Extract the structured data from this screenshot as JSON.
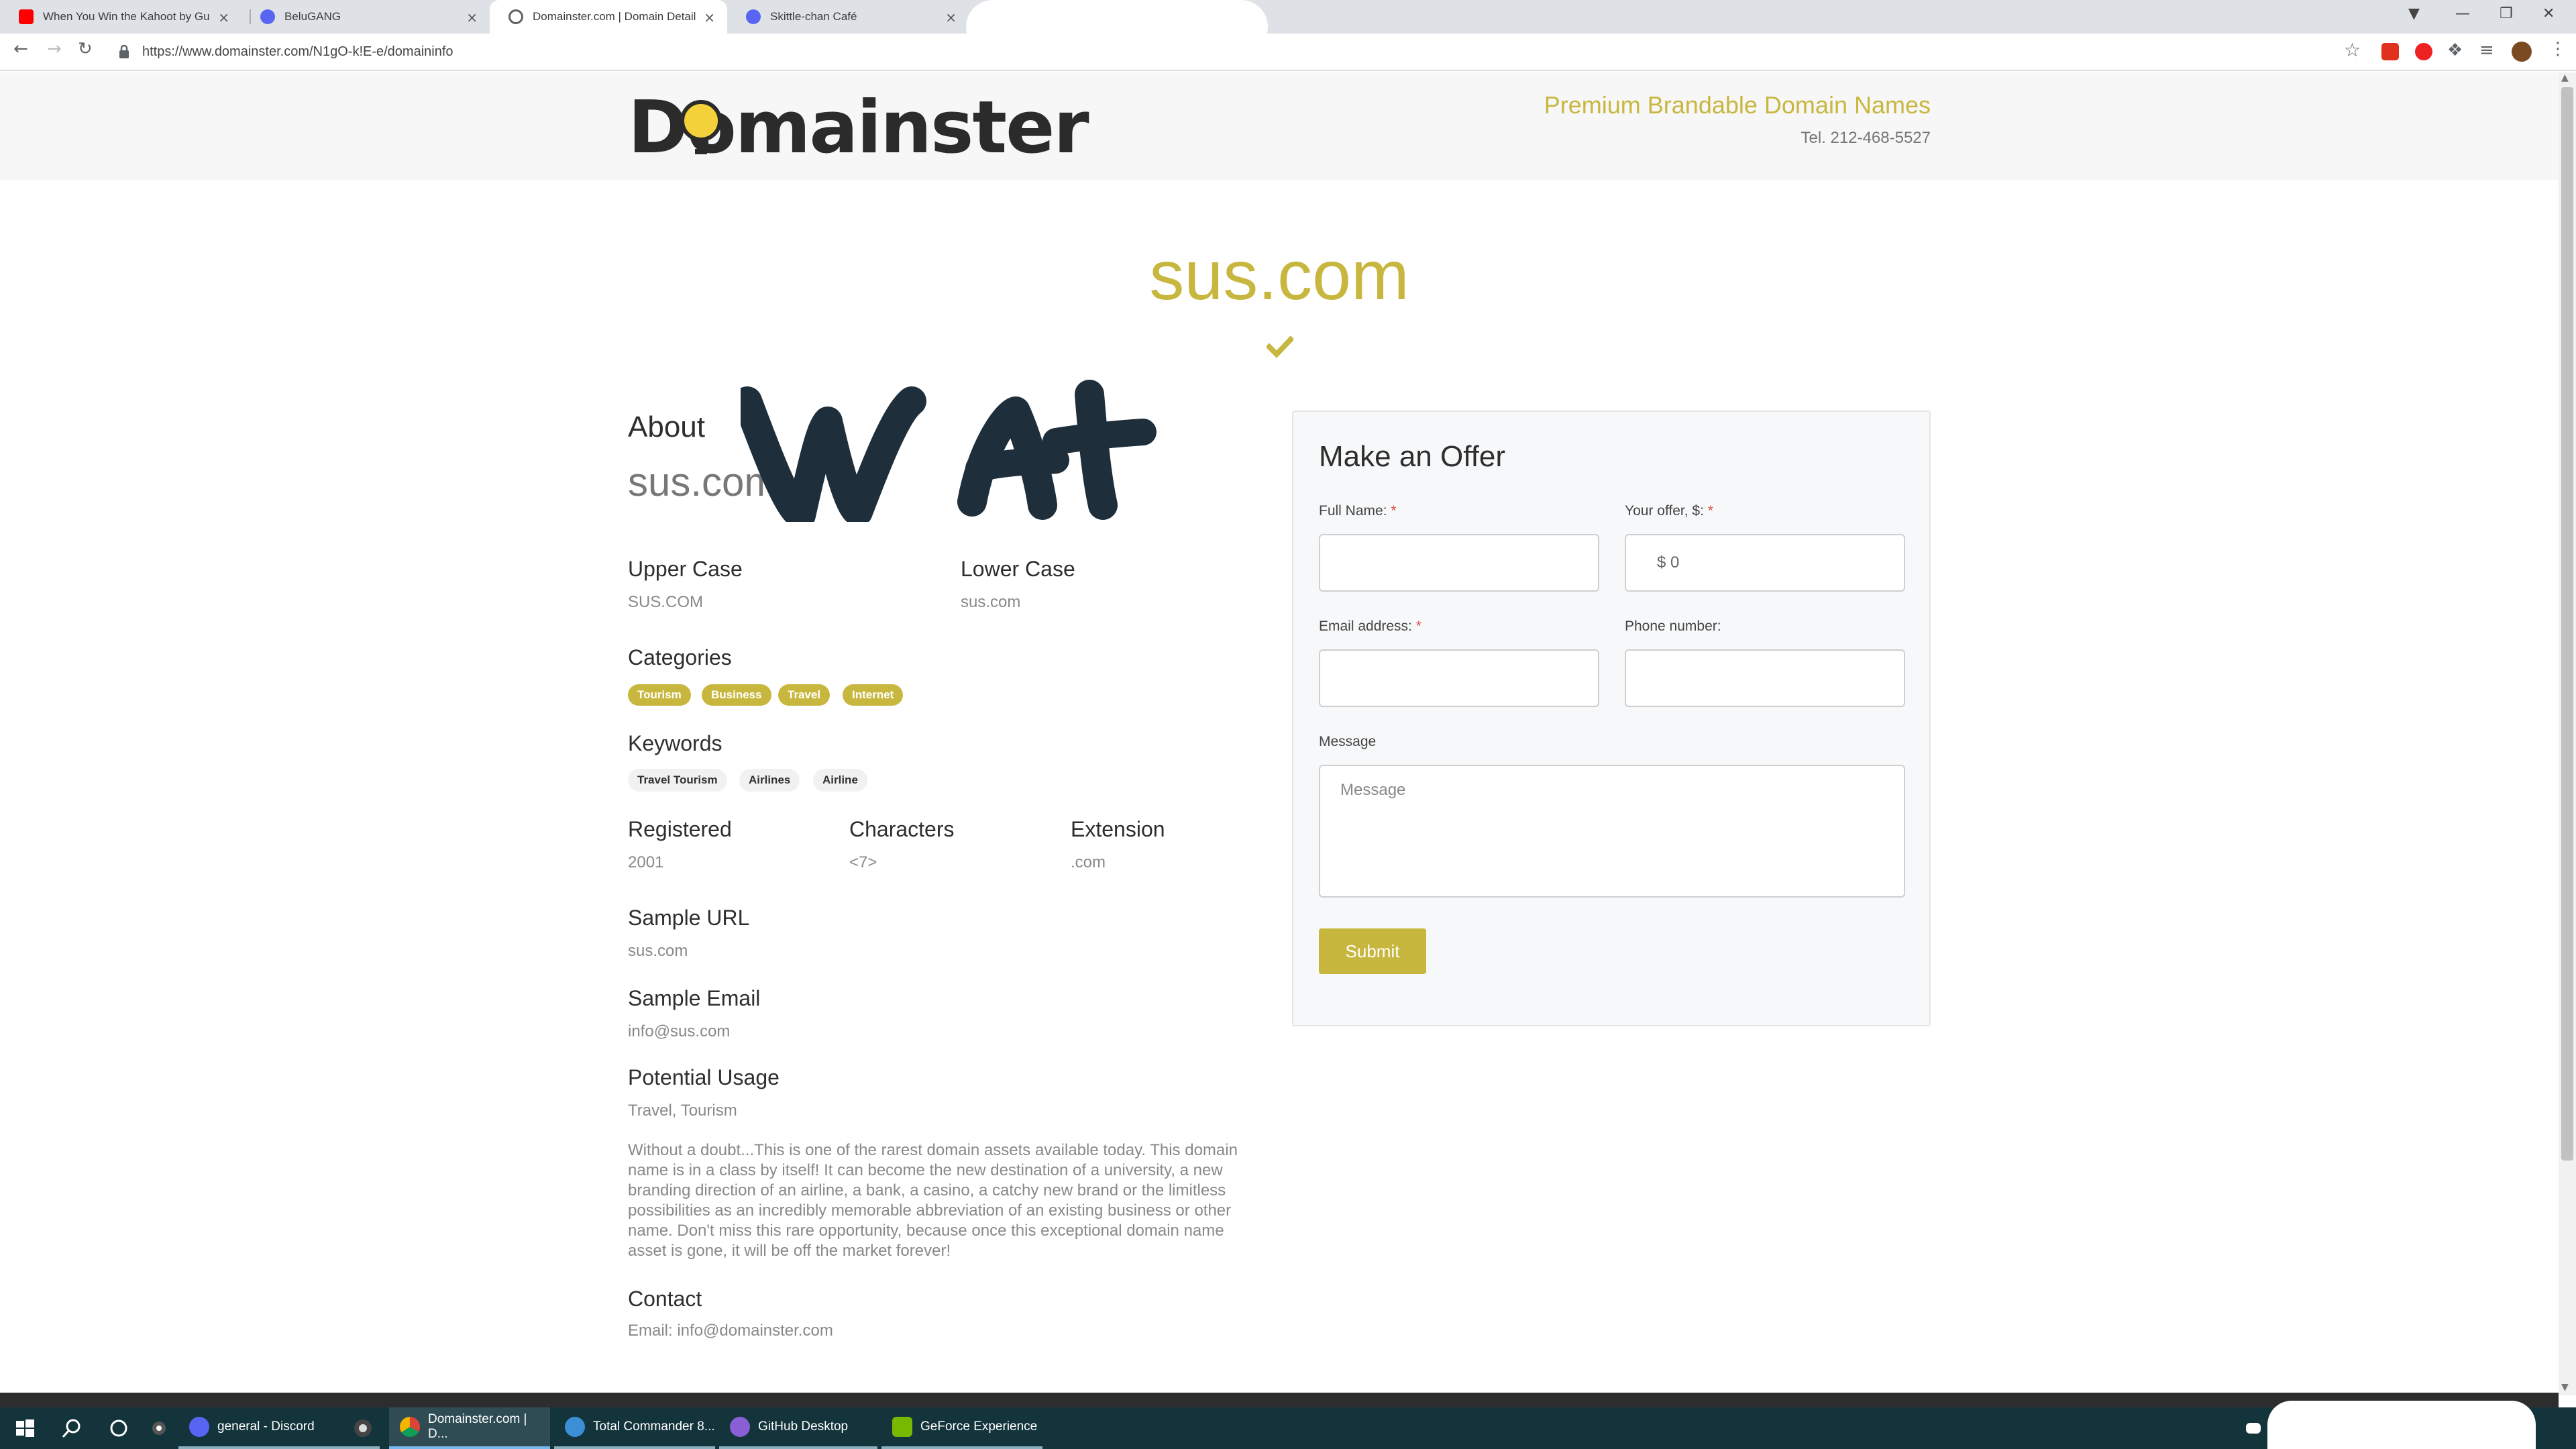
{
  "browser": {
    "tabs": [
      {
        "title": "When You Win the Kahoot by Gu",
        "favicon": "youtube-icon"
      },
      {
        "title": "BeluGANG",
        "favicon": "discord-icon"
      },
      {
        "title": "Domainster.com | Domain Detail",
        "favicon": "globe-icon"
      },
      {
        "title": "Skittle-chan Café",
        "favicon": "discord-icon"
      }
    ],
    "url": "https://www.domainster.com/N1gO-k!E-e/domaininfo"
  },
  "site": {
    "logo": "Domainster",
    "tagline": "Premium Brandable Domain Names",
    "tel": "Tel. 212-468-5527"
  },
  "domain": {
    "name": "sus.com",
    "about_heading": "About",
    "about_name": "sus.com",
    "scribble_text": "WAt",
    "upper_label": "Upper Case",
    "upper_value": "SUS.COM",
    "lower_label": "Lower Case",
    "lower_value": "sus.com",
    "categories_label": "Categories",
    "categories": [
      "Tourism",
      "Business",
      "Travel",
      "Internet"
    ],
    "keywords_label": "Keywords",
    "keywords": [
      "Travel Tourism",
      "Airlines",
      "Airline"
    ],
    "registered_label": "Registered",
    "registered_value": "2001",
    "characters_label": "Characters",
    "characters_value": "<7>",
    "extension_label": "Extension",
    "extension_value": ".com",
    "sample_url_label": "Sample URL",
    "sample_url_value": "sus.com",
    "sample_email_label": "Sample Email",
    "sample_email_value": "info@sus.com",
    "potential_usage_label": "Potential Usage",
    "potential_usage_value": "Travel, Tourism",
    "description": "Without a doubt...This is one of the rarest domain assets available today. This domain name is in a class by itself! It can become the new destination of a university, a new branding direction of an airline, a bank, a casino, a catchy new brand or the limitless possibilities as an incredibly memorable abbreviation of an existing business or other name. Don't miss this rare opportunity, because once this exceptional domain name asset is gone, it will be off the market forever!",
    "contact_label": "Contact",
    "contact_value": "Email: info@domainster.com"
  },
  "offer": {
    "title": "Make an Offer",
    "full_name_label": "Full Name:",
    "offer_label": "Your offer, $:",
    "offer_placeholder": "$ 0",
    "email_label": "Email address:",
    "phone_label": "Phone number:",
    "message_label": "Message",
    "message_placeholder": "Message",
    "required_mark": "*",
    "submit_label": "Submit"
  },
  "taskbar": {
    "apps": [
      {
        "label": "general - Discord",
        "icon": "discord-icon"
      },
      {
        "label": "Domainster.com | D...",
        "icon": "chrome-icon"
      },
      {
        "label": "Total Commander 8...",
        "icon": "total-commander-icon"
      },
      {
        "label": "GitHub Desktop",
        "icon": "github-icon"
      },
      {
        "label": "GeForce Experience",
        "icon": "nvidia-icon"
      }
    ]
  },
  "colors": {
    "accent": "#c8b73e",
    "taskbar": "#14343c",
    "scribble": "#1e2e3a"
  }
}
